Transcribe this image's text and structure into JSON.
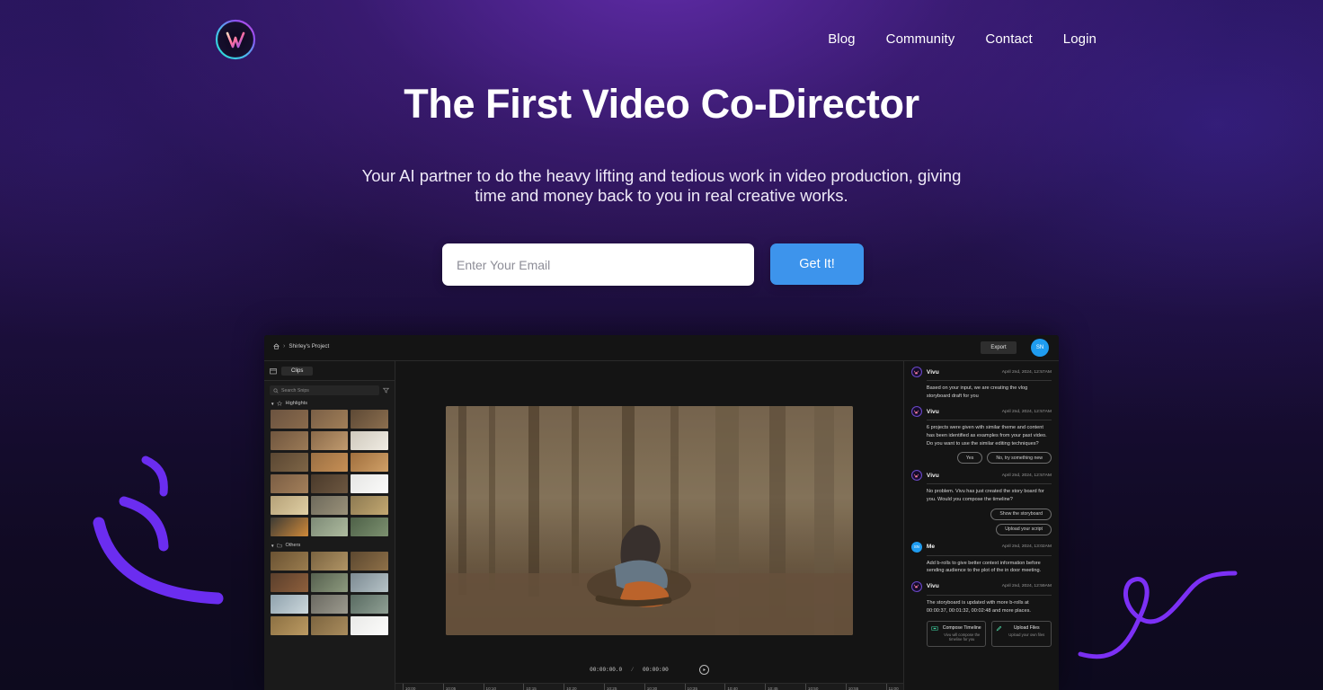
{
  "brand": {
    "logo_name": "vivu-logo",
    "accent": "#7d3cff",
    "cta_color": "#3d94ec"
  },
  "nav": {
    "items": [
      {
        "label": "Blog",
        "name": "nav-blog"
      },
      {
        "label": "Community",
        "name": "nav-community"
      },
      {
        "label": "Contact",
        "name": "nav-contact"
      },
      {
        "label": "Login",
        "name": "nav-login"
      }
    ]
  },
  "hero": {
    "headline": "The First Video Co-Director",
    "subheadline": "Your AI partner to do the heavy lifting and tedious work in video production, giving time and money back to you in real creative works.",
    "email_placeholder": "Enter Your Email",
    "email_value": "",
    "cta_label": "Get It!"
  },
  "app": {
    "topbar": {
      "home_icon": "home-icon",
      "breadcrumb_separator": "›",
      "project_name": "Shirley's Project",
      "export_label": "Export",
      "avatar_initials": "SN"
    },
    "clips": {
      "panel_icon": "panel-icon",
      "tab_label": "Clips",
      "search_placeholder": "Search Snips",
      "search_icon": "search-icon",
      "filter_icon": "filter-icon",
      "sections": [
        {
          "label": "Highlights",
          "icon": "star-icon",
          "count": 18
        },
        {
          "label": "Others",
          "icon": "folder-icon",
          "count": 12
        }
      ]
    },
    "player": {
      "current_time": "00:00:00.0",
      "separator": "/",
      "duration": "00:00:00",
      "play_icon": "play-icon"
    },
    "timeline": {
      "ticks": [
        "10:00",
        "10:05",
        "10:10",
        "10:15",
        "10:20",
        "10:25",
        "10:30",
        "10:35",
        "10:40",
        "10:45",
        "10:50",
        "10:55",
        "11:00"
      ]
    },
    "chat": {
      "messages": [
        {
          "author": "Vivu",
          "is_me": false,
          "avatar": "vivu-mark",
          "time": "April 2nd, 2024, 12:57AM",
          "text": "Based on your input, we are creating the vlog storyboard draft for you",
          "actions": []
        },
        {
          "author": "Vivu",
          "is_me": false,
          "avatar": "vivu-mark",
          "time": "April 2nd, 2024, 12:57AM",
          "text": "6 projects were given with similar theme and content has been identified as examples from your past video. Do you want to use the similar editing techniques?",
          "actions": [
            "Yes",
            "No, try something new"
          ]
        },
        {
          "author": "Vivu",
          "is_me": false,
          "avatar": "vivu-mark",
          "time": "April 2nd, 2024, 12:57AM",
          "text": "No problem. Vivu has just created the story board for you. Would you compose the timeline?",
          "actions": [
            "Show the storyboard",
            "Upload your script"
          ]
        },
        {
          "author": "Me",
          "is_me": true,
          "avatar": "SN",
          "time": "April 2nd, 2024, 13:02AM",
          "text": "Add b-rolls to give better context information before sending audience to the plot of the in door meeting.",
          "actions": []
        },
        {
          "author": "Vivu",
          "is_me": false,
          "avatar": "vivu-mark",
          "time": "April 2nd, 2024, 12:59AM",
          "text": "The storyboard is updated with more b-rolls at 00:00:37, 00:01:32, 00:02:48 and more places.",
          "actions": []
        }
      ],
      "cards": [
        {
          "icon": "compose-icon",
          "title": "Compose Timeline",
          "sub": "Vivu will compose the timeline for you"
        },
        {
          "icon": "pencil-icon",
          "title": "Upload Files",
          "sub": "Upload your own files"
        }
      ]
    }
  }
}
